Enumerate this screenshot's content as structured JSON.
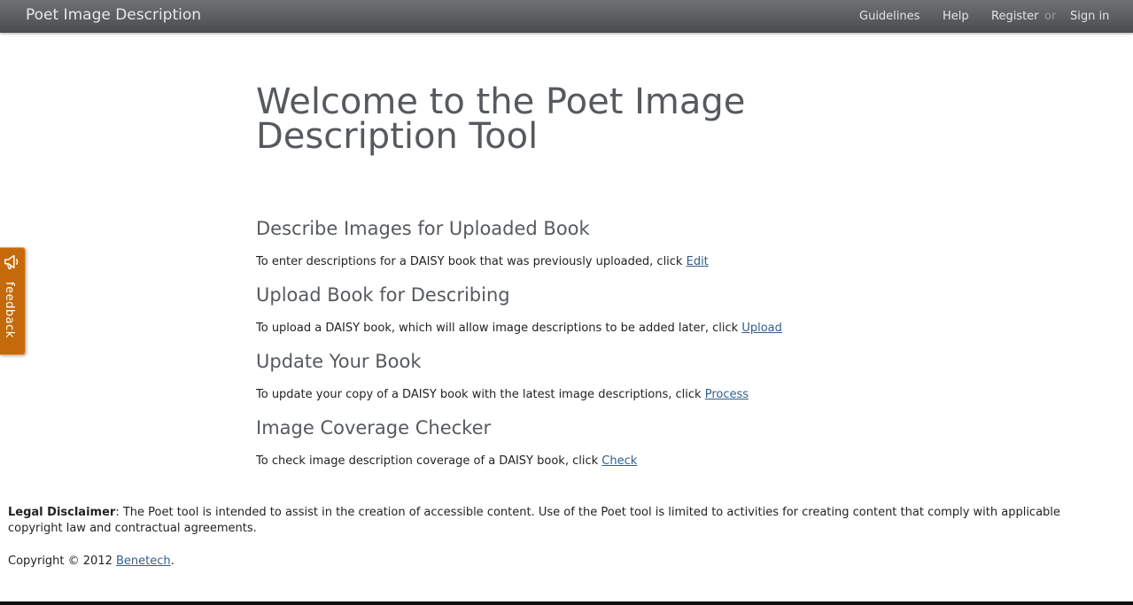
{
  "navbar": {
    "brand": "Poet Image Description",
    "links": {
      "guidelines": "Guidelines",
      "help": "Help",
      "register": "Register",
      "or": "or",
      "sign_in": "Sign in"
    }
  },
  "main": {
    "title": "Welcome to the Poet Image Description Tool",
    "sections": [
      {
        "heading": "Describe Images for Uploaded Book",
        "text": "To enter descriptions for a DAISY book that was previously uploaded, click ",
        "link": "Edit"
      },
      {
        "heading": "Upload Book for Describing",
        "text": "To upload a DAISY book, which will allow image descriptions to be added later, click ",
        "link": "Upload"
      },
      {
        "heading": "Update Your Book",
        "text": "To update your copy of a DAISY book with the latest image descriptions, click ",
        "link": "Process"
      },
      {
        "heading": "Image Coverage Checker",
        "text": "To check image description coverage of a DAISY book, click ",
        "link": "Check"
      }
    ]
  },
  "feedback": {
    "label": "feedback",
    "icon": "megaphone-icon",
    "color": "#c46a0a"
  },
  "footer": {
    "disclaimer_label": "Legal Disclaimer",
    "disclaimer_text": ": The Poet tool is intended to assist in the creation of accessible content. Use of the Poet tool is limited to activities for creating content that comply with applicable copyright law and contractual agreements.",
    "copyright_text": "Copyright © 2012 ",
    "copyright_link": "Benetech",
    "copyright_end": "."
  },
  "colors": {
    "navbar": "#55595c",
    "heading": "#565a5e",
    "link": "#2f5f8c"
  }
}
